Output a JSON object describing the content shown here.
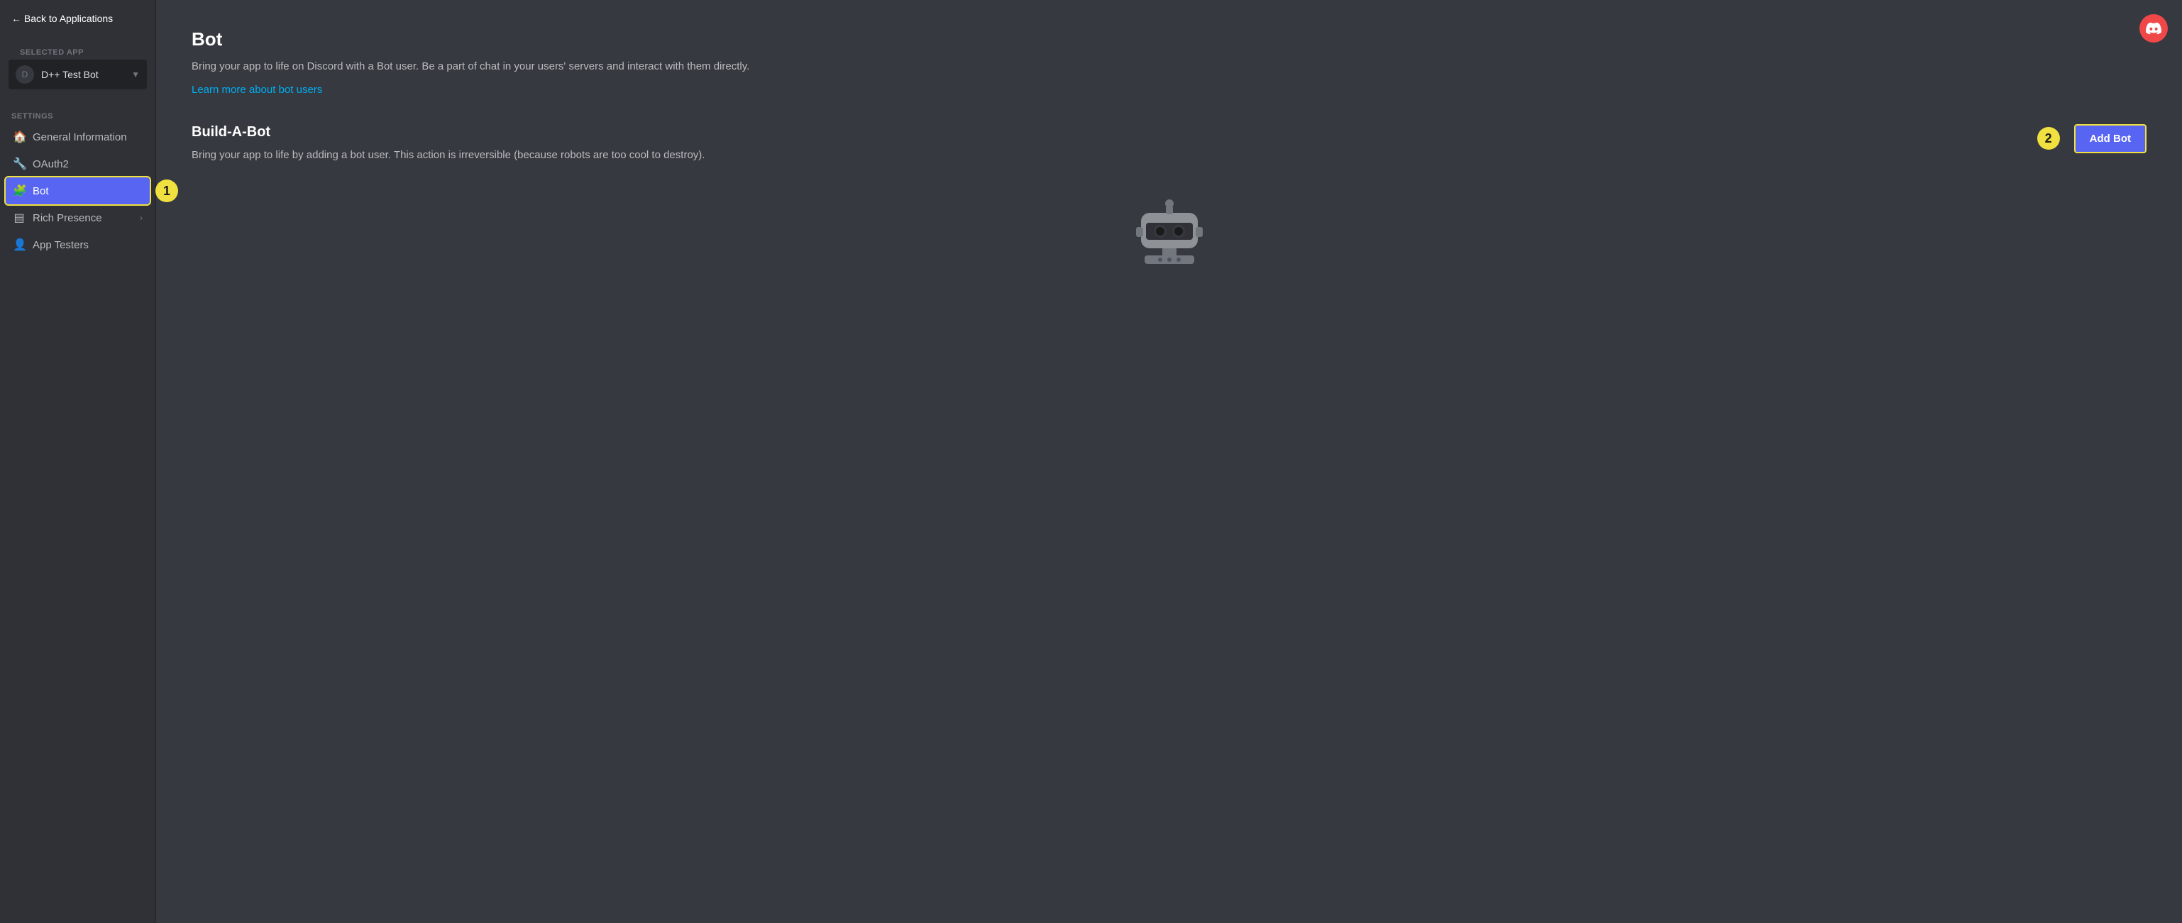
{
  "sidebar": {
    "back_label": "← Back to Applications",
    "selected_app_label": "SELECTED APP",
    "app_name": "D++ Test Bot",
    "settings_label": "SETTINGS",
    "nav_items": [
      {
        "id": "general-information",
        "label": "General Information",
        "icon": "🏠",
        "active": false,
        "has_chevron": false
      },
      {
        "id": "oauth2",
        "label": "OAuth2",
        "icon": "🔧",
        "active": false,
        "has_chevron": false
      },
      {
        "id": "bot",
        "label": "Bot",
        "icon": "🧩",
        "active": true,
        "has_chevron": false
      },
      {
        "id": "rich-presence",
        "label": "Rich Presence",
        "icon": "▤",
        "active": false,
        "has_chevron": true
      },
      {
        "id": "app-testers",
        "label": "App Testers",
        "icon": "👤",
        "active": false,
        "has_chevron": false
      }
    ]
  },
  "main": {
    "page_title": "Bot",
    "page_description": "Bring your app to life on Discord with a Bot user. Be a part of chat in your users' servers and interact with them directly.",
    "learn_more_link": "Learn more about bot users",
    "build_a_bot_title": "Build-A-Bot",
    "build_a_bot_desc": "Bring your app to life by adding a bot user. This action is irreversible (because robots are too cool to destroy).",
    "add_bot_label": "Add Bot"
  },
  "annotations": {
    "one": "1",
    "two": "2"
  },
  "discord_logo": "🎮"
}
